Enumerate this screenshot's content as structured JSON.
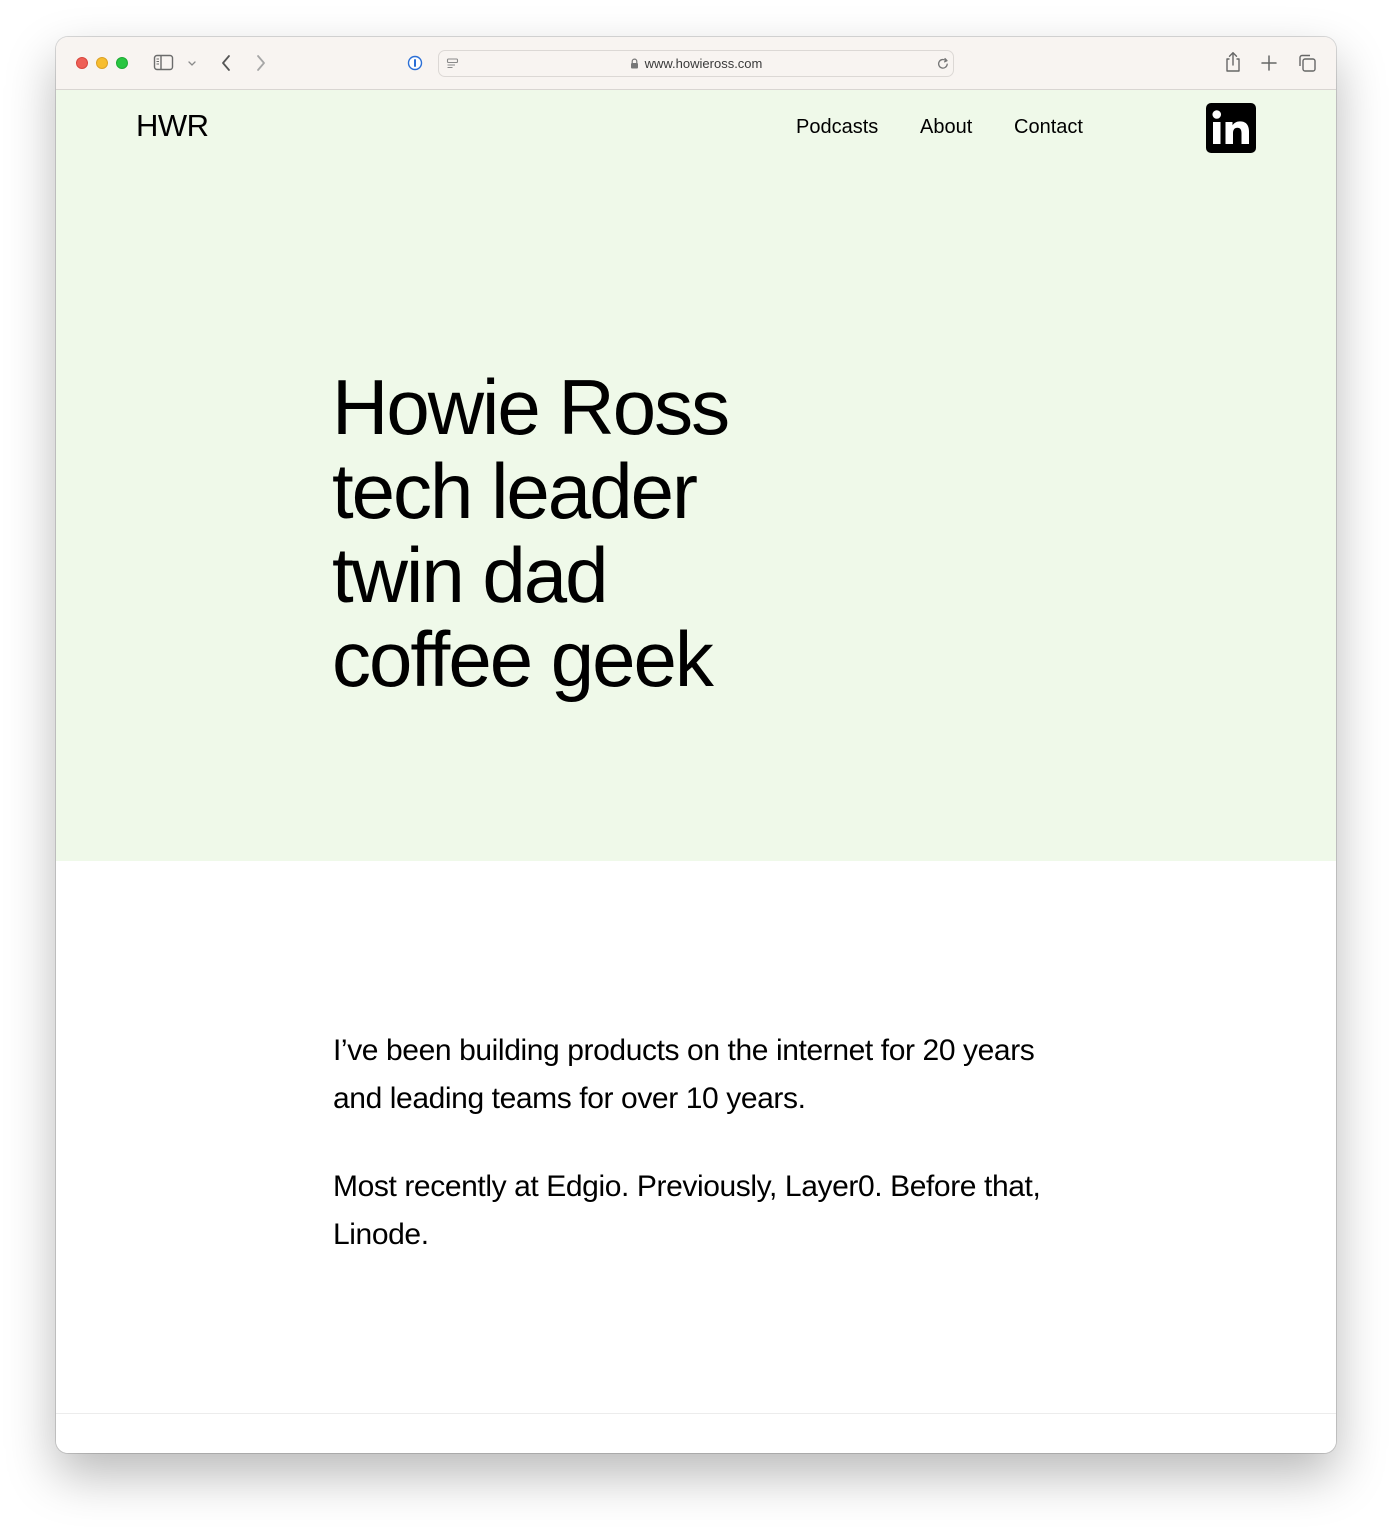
{
  "browser": {
    "url": "www.howieross.com",
    "icons": [
      "sidebar-icon",
      "chevron-down-icon",
      "back-icon",
      "forward-icon",
      "password-icon",
      "reader-icon",
      "lock-icon",
      "reload-icon",
      "share-icon",
      "new-tab-icon",
      "tabs-overview-icon"
    ]
  },
  "site": {
    "logo": "HWR",
    "nav": [
      "Podcasts",
      "About",
      "Contact"
    ],
    "social_icon": "linkedin-icon",
    "hero_background": "#eff9e9"
  },
  "hero": {
    "lines": [
      "Howie Ross",
      "tech leader",
      "twin dad",
      "coffee geek"
    ]
  },
  "bio": [
    "I’ve been building products on the internet for 20 years and leading teams for over 10 years.",
    "Most recently at Edgio. Previously, Layer0. Before that, Linode."
  ]
}
